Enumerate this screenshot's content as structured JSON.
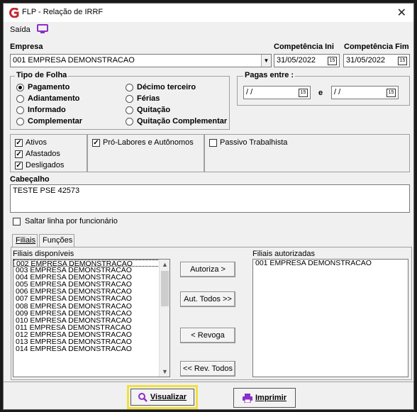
{
  "window": {
    "title": "FLP - Relação de IRRF",
    "close_label": "✕"
  },
  "menu": {
    "saida": "Saída"
  },
  "empresa": {
    "label": "Empresa",
    "value": "001 EMPRESA DEMONSTRACAO"
  },
  "competencia": {
    "ini_label": "Competência Ini",
    "ini_value": "31/05/2022",
    "fim_label": "Competência Fim",
    "fim_value": "31/05/2022"
  },
  "tipo_folha": {
    "title": "Tipo de Folha",
    "options": [
      "Pagamento",
      "Adiantamento",
      "Informado",
      "Complementar",
      "Décimo terceiro",
      "Férias",
      "Quitação",
      "Quitação Complementar"
    ],
    "selected": "Pagamento"
  },
  "pagas_entre": {
    "title": "Pagas entre :",
    "from": "/ /",
    "and_label": "e",
    "to": "/ /"
  },
  "checks": {
    "ativos": "Ativos",
    "afastados": "Afastados",
    "desligados": "Desligados",
    "pro_labores": "Pró-Labores e Autônomos",
    "passivo": "Passivo Trabalhista"
  },
  "cabecalho": {
    "label": "Cabeçalho",
    "value": "TESTE PSE 42573"
  },
  "saltar_linha": "Saltar linha por funcionário",
  "tabs": [
    "Filiais",
    "Funções"
  ],
  "filiais": {
    "disponiveis_label": "Filiais disponíveis",
    "disponiveis": [
      "002 EMPRESA DEMONSTRACAO",
      "003 EMPRESA DEMONSTRACAO",
      "004 EMPRESA DEMONSTRACAO",
      "005 EMPRESA DEMONSTRACAO",
      "006 EMPRESA DEMONSTRACAO",
      "007 EMPRESA DEMONSTRACAO",
      "008 EMPRESA DEMONSTRACAO",
      "009 EMPRESA DEMONSTRACAO",
      "010 EMPRESA DEMONSTRACAO",
      "011 EMPRESA DEMONSTRACAO",
      "012 EMPRESA DEMONSTRACAO",
      "013 EMPRESA DEMONSTRACAO",
      "014 EMPRESA DEMONSTRACAO"
    ],
    "autorizadas_label": "Filiais autorizadas",
    "autorizadas": [
      "001 EMPRESA DEMONSTRACAO"
    ]
  },
  "buttons": {
    "autoriza": "Autoriza >",
    "aut_todos": "Aut. Todos >>",
    "revoga": "< Revoga",
    "rev_todos": "<< Rev. Todos",
    "visualizar": "Visualizar",
    "imprimir": "Imprimir"
  },
  "colors": {
    "highlight": "#f0e040",
    "logo": "#c0282d",
    "accent": "#8b2fc9"
  }
}
